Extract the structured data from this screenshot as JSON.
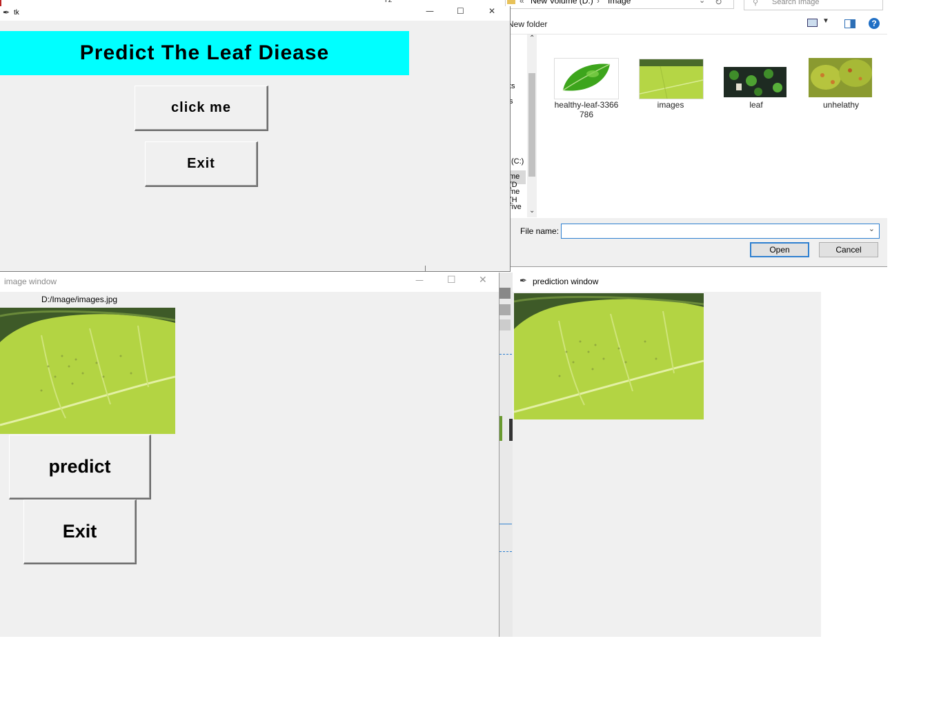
{
  "explorer": {
    "breadcrumb_prefix": "«",
    "breadcrumb_drive": "New Volume (D:)",
    "breadcrumb_sep": "›",
    "breadcrumb_folder": "Image",
    "search_placeholder": "Search Image",
    "new_folder_label": "New folder",
    "nav_items": [
      "ts",
      "s",
      "(C:)",
      "me (D",
      "me (H",
      "rive"
    ],
    "files": [
      {
        "name": "healthy-leaf-3366786",
        "line1": "healthy-leaf-3366",
        "line2": "786"
      },
      {
        "name": "images",
        "line1": "images",
        "line2": ""
      },
      {
        "name": "leaf",
        "line1": "leaf",
        "line2": ""
      },
      {
        "name": "unhelathy",
        "line1": "unhelathy",
        "line2": ""
      }
    ],
    "file_name_label": "File name:",
    "file_name_value": "",
    "open_label": "Open",
    "cancel_label": "Cancel",
    "top_fragment": "Tz"
  },
  "tk_window": {
    "title": "tk",
    "heading": "Predict The Leaf Diease",
    "heading_bg": "#00ffff",
    "click_label": "click me",
    "exit_label": "Exit"
  },
  "image_window": {
    "title": "image  window",
    "path": "D:/Image/images.jpg",
    "predict_label": "predict",
    "exit_label": "Exit"
  },
  "prediction_window": {
    "title": "prediction window"
  },
  "controls": {
    "minimize": "—",
    "maximize": "☐",
    "close": "✕"
  }
}
